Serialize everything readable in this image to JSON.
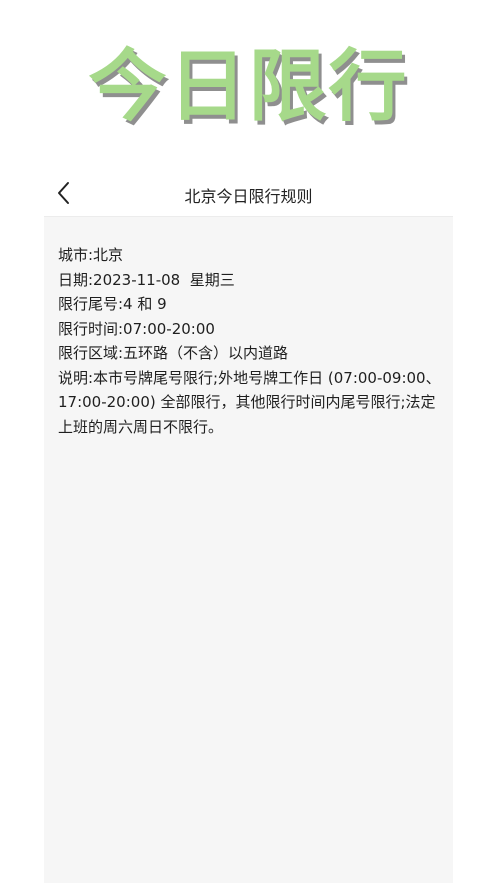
{
  "hero": {
    "title": "今日限行"
  },
  "nav": {
    "title": "北京今日限行规则",
    "back_icon": "chevron-left-icon"
  },
  "rules": {
    "city": "城市:北京",
    "date": "日期:2023-11-08  星期三",
    "tail_numbers": "限行尾号:4 和 9",
    "time": "限行时间:07:00-20:00",
    "area": "限行区域:五环路（不含）以内道路",
    "description": "说明:本市号牌尾号限行;外地号牌工作日 (07:00-09:00、17:00-20:00) 全部限行，其他限行时间内尾号限行;法定上班的周六周日不限行。"
  },
  "colors": {
    "hero_green": "#a6d98a",
    "hero_shadow": "#8f8f8f",
    "content_background": "#f6f6f6"
  }
}
